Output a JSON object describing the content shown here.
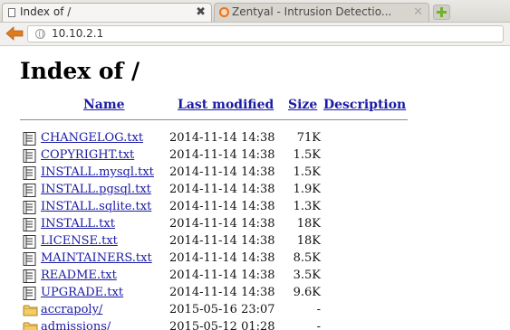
{
  "browser": {
    "tabs": [
      {
        "title": "Index of /",
        "close": "✖"
      },
      {
        "title": "Zentyal - Intrusion Detectio...",
        "close": "✕"
      }
    ],
    "url": "10.10.2.1"
  },
  "page": {
    "title": "Index of /",
    "columns": {
      "name": "Name",
      "last_modified": "Last modified",
      "size": "Size",
      "description": "Description"
    },
    "rows": [
      {
        "type": "file",
        "name": "CHANGELOG.txt",
        "modified": "2014-11-14 14:38",
        "size": "71K"
      },
      {
        "type": "file",
        "name": "COPYRIGHT.txt",
        "modified": "2014-11-14 14:38",
        "size": "1.5K"
      },
      {
        "type": "file",
        "name": "INSTALL.mysql.txt",
        "modified": "2014-11-14 14:38",
        "size": "1.5K"
      },
      {
        "type": "file",
        "name": "INSTALL.pgsql.txt",
        "modified": "2014-11-14 14:38",
        "size": "1.9K"
      },
      {
        "type": "file",
        "name": "INSTALL.sqlite.txt",
        "modified": "2014-11-14 14:38",
        "size": "1.3K"
      },
      {
        "type": "file",
        "name": "INSTALL.txt",
        "modified": "2014-11-14 14:38",
        "size": "18K"
      },
      {
        "type": "file",
        "name": "LICENSE.txt",
        "modified": "2014-11-14 14:38",
        "size": "18K"
      },
      {
        "type": "file",
        "name": "MAINTAINERS.txt",
        "modified": "2014-11-14 14:38",
        "size": "8.5K"
      },
      {
        "type": "file",
        "name": "README.txt",
        "modified": "2014-11-14 14:38",
        "size": "3.5K"
      },
      {
        "type": "file",
        "name": "UPGRADE.txt",
        "modified": "2014-11-14 14:38",
        "size": "9.6K"
      },
      {
        "type": "folder",
        "name": "accrapoly/",
        "modified": "2015-05-16 23:07",
        "size": "-"
      },
      {
        "type": "folder",
        "name": "admissions/",
        "modified": "2015-05-12 01:28",
        "size": "-"
      }
    ]
  },
  "colors": {
    "link": "#1a1aa6",
    "back_arrow": "#e07a1f",
    "zentyal_icon": "#e8731d",
    "new_tab_plus": "#6fb329"
  }
}
